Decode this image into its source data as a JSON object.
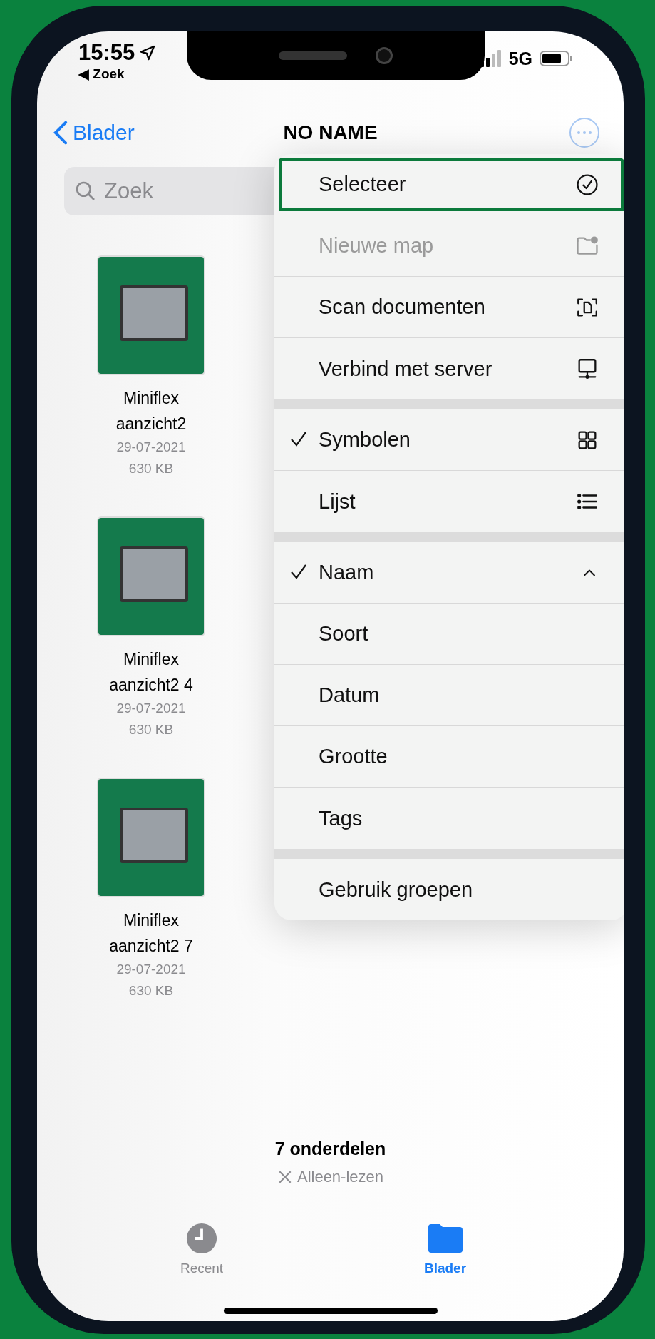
{
  "status_bar": {
    "time": "15:55",
    "back_link": "◀ Zoek",
    "network": "5G"
  },
  "nav": {
    "back": "Blader",
    "title": "NO NAME"
  },
  "search": {
    "placeholder": "Zoek"
  },
  "files": [
    {
      "name": "Miniflex aanzicht2",
      "date": "29-07-2021",
      "size": "630 KB"
    },
    {
      "name": "Miniflex aanzicht2 4",
      "date": "29-07-2021",
      "size": "630 KB"
    },
    {
      "name": "Miniflex aanzicht2 7",
      "date": "29-07-2021",
      "size": "630 KB"
    }
  ],
  "menu": {
    "groups": [
      {
        "items": [
          {
            "label": "Selecteer",
            "selected": true,
            "checked": false,
            "disabled": false
          },
          {
            "label": "Nieuwe map",
            "selected": false,
            "checked": false,
            "disabled": true
          },
          {
            "label": "Scan documenten",
            "selected": false,
            "checked": false,
            "disabled": false
          },
          {
            "label": "Verbind met server",
            "selected": false,
            "checked": false,
            "disabled": false
          }
        ]
      },
      {
        "items": [
          {
            "label": "Symbolen",
            "selected": false,
            "checked": true,
            "disabled": false
          },
          {
            "label": "Lijst",
            "selected": false,
            "checked": false,
            "disabled": false
          }
        ]
      },
      {
        "items": [
          {
            "label": "Naam",
            "selected": false,
            "checked": true,
            "disabled": false
          },
          {
            "label": "Soort",
            "selected": false,
            "checked": false,
            "disabled": false
          },
          {
            "label": "Datum",
            "selected": false,
            "checked": false,
            "disabled": false
          },
          {
            "label": "Grootte",
            "selected": false,
            "checked": false,
            "disabled": false
          },
          {
            "label": "Tags",
            "selected": false,
            "checked": false,
            "disabled": false
          }
        ]
      },
      {
        "items": [
          {
            "label": "Gebruik groepen",
            "selected": false,
            "checked": false,
            "disabled": false
          }
        ]
      }
    ]
  },
  "footer": {
    "count": "7 onderdelen",
    "access": "Alleen-lezen"
  },
  "tabs": [
    {
      "label": "Recent",
      "selected": false
    },
    {
      "label": "Blader",
      "selected": true
    }
  ]
}
